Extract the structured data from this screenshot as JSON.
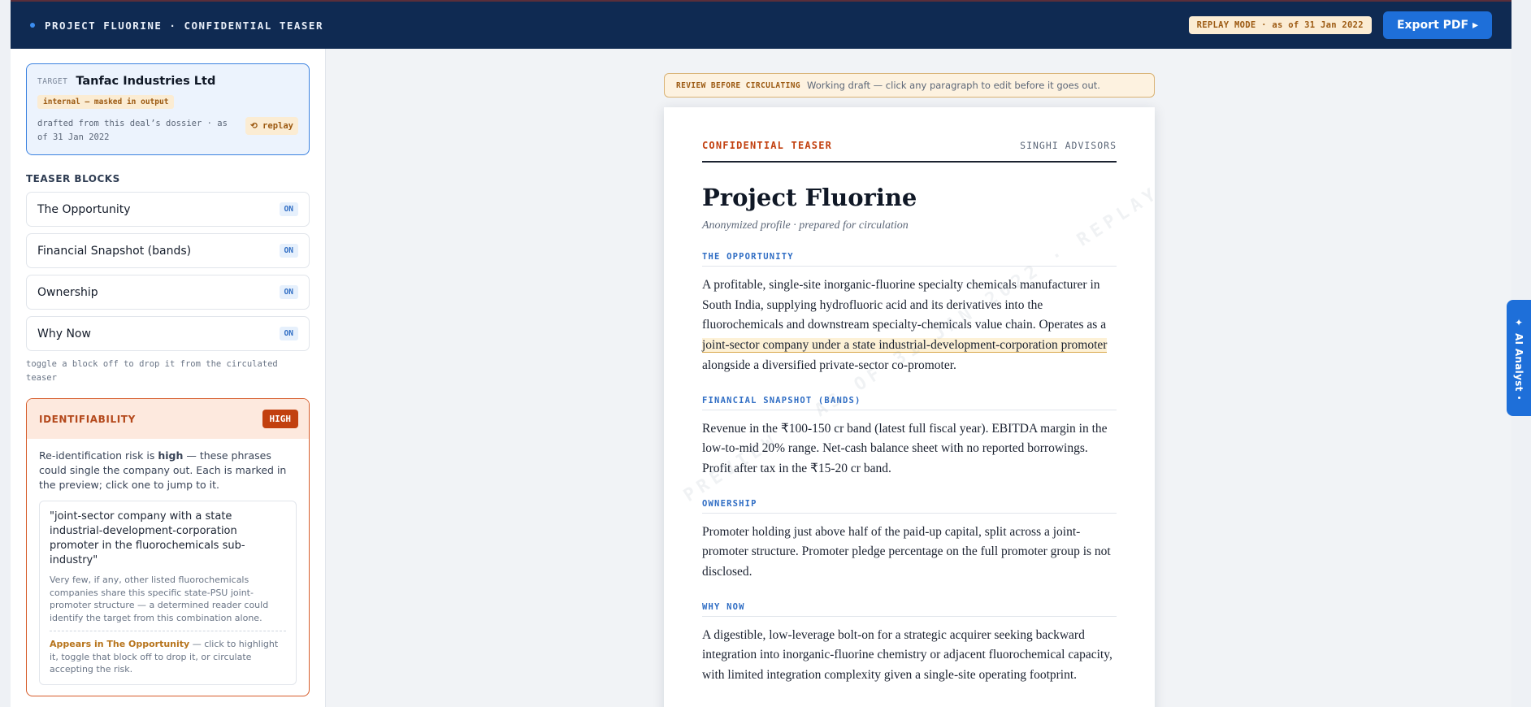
{
  "topbar": {
    "title": "PROJECT FLUORINE · CONFIDENTIAL TEASER",
    "replay_badge": "REPLAY MODE · as of 31 Jan 2022",
    "export_label": "Export PDF ▸"
  },
  "sidebar": {
    "target": {
      "label": "TARGET",
      "name": "Tanfac Industries Ltd",
      "mask_note": "internal — masked in output",
      "drafted": "drafted from this deal’s dossier · as of 31 Jan 2022",
      "replay_label": "⟲ replay"
    },
    "blocks_heading": "TEASER BLOCKS",
    "blocks": [
      {
        "label": "The Opportunity",
        "state": "ON"
      },
      {
        "label": "Financial Snapshot (bands)",
        "state": "ON"
      },
      {
        "label": "Ownership",
        "state": "ON"
      },
      {
        "label": "Why Now",
        "state": "ON"
      }
    ],
    "toggle_hint": "toggle a block off to drop it from the circulated teaser",
    "identifiability": {
      "title": "IDENTIFIABILITY",
      "level": "HIGH",
      "desc_pre": "Re-identification risk is ",
      "desc_strong": "high",
      "desc_post": " — these phrases could single the company out. Each is marked in the preview; click one to jump to it.",
      "phrase": {
        "quote": "\"joint-sector company with a state industrial-development-corporation promoter in the fluorochemicals sub-industry\"",
        "explanation": "Very few, if any, other listed fluorochemicals companies share this specific state-PSU joint-promoter structure — a determined reader could identify the target from this combination alone.",
        "appears_label": "Appears in The Opportunity",
        "appears_rest": " — click to highlight it, toggle that block off to drop it, or circulate accepting the risk."
      }
    }
  },
  "main": {
    "review_tag": "REVIEW BEFORE CIRCULATING",
    "review_text": "Working draft — click any paragraph to edit before it goes out.",
    "doc": {
      "confidential": "CONFIDENTIAL TEASER",
      "advisor": "SINGHI ADVISORS",
      "title": "Project Fluorine",
      "subtitle": "Anonymized profile · prepared for circulation",
      "watermark": "PREVIEW · AS OF 31 JAN 2022 · REPLAY",
      "sections": {
        "opportunity": {
          "heading": "THE OPPORTUNITY",
          "text_pre": "A profitable, single-site inorganic-fluorine specialty chemicals manufacturer in South India, supplying hydrofluoric acid and its derivatives into the fluorochemicals and downstream specialty-chemicals value chain. Operates as a ",
          "text_highlight": "joint-sector company under a state industrial-development-corporation promoter",
          "text_post": " alongside a diversified private-sector co-promoter."
        },
        "financial": {
          "heading": "FINANCIAL SNAPSHOT (BANDS)",
          "text": "Revenue in the ₹100-150 cr band (latest full fiscal year). EBITDA margin in the low-to-mid 20% range. Net-cash balance sheet with no reported borrowings. Profit after tax in the ₹15-20 cr band."
        },
        "ownership": {
          "heading": "OWNERSHIP",
          "text": "Promoter holding just above half of the paid-up capital, split across a joint-promoter structure. Promoter pledge percentage on the full promoter group is not disclosed."
        },
        "why_now": {
          "heading": "WHY NOW",
          "text": "A digestible, low-leverage bolt-on for a strategic acquirer seeking backward integration into inorganic-fluorine chemistry or adjacent fluorochemical capacity, with limited integration complexity given a single-site operating footprint."
        }
      }
    }
  },
  "ai_tab": {
    "label": "AI Analyst"
  }
}
